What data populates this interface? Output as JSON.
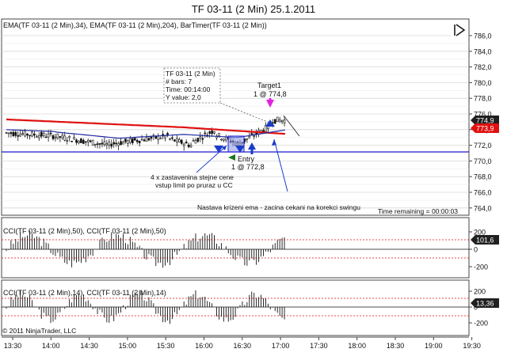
{
  "window": {
    "title": "TF 03-11 (2 Min)  25.1.2011"
  },
  "colors": {
    "ema_fast": "#1f2a9e",
    "ema_slow": "#e01010",
    "hline": "#1a1ad0",
    "price_tag": "#e01010",
    "price_tag2": "#202020",
    "grid": "#d8d8d8",
    "arrow": "#1a3cc8",
    "target": "#e020e0",
    "entry": "#1a7a1a"
  },
  "toolbar": {
    "collapse_icon": "collapse-right-icon"
  },
  "price_panel": {
    "indicator_label": "EMA(TF 03-11 (2 Min),34), EMA(TF 03-11 (2 Min),204), BarTimer(TF 03-11 (2 Min))",
    "y_ticks": [
      "786,0",
      "784,0",
      "782,0",
      "780,0",
      "778,0",
      "776,0",
      "774,0",
      "772,0",
      "770,0",
      "768,0",
      "766,0",
      "764,0"
    ],
    "last_price": "774,9",
    "ema_value": "773,9",
    "tooltip": {
      "line1": "TF 03-11 (2 Min)",
      "line2": "# bars:   7",
      "line3": "Time:     00:14:00",
      "line4": "Y value: 2,0"
    },
    "target_label1": "Target1",
    "target_label2": "1 @ 774,8",
    "entry_label1": "Entry",
    "entry_label2": "1 @ 772,8",
    "note_limit1": "4 x zastavenina stejne cene",
    "note_limit2": "vstup limit po pruraz u CC",
    "note_cross": "Nastava krizeni ema - zacina cekani na korekci swingu",
    "time_remaining": "Time remaining = 00:00:03"
  },
  "cci_panel_1": {
    "label": "CCI(TF 03-11 (2 Min),50), CCI(TF 03-11 (2 Min),50)",
    "y_ticks": [
      "200",
      "0",
      "-200"
    ],
    "last_value": "101,6"
  },
  "cci_panel_2": {
    "label": "CCI(TF 03-11 (2 Min),14), CCI(TF 03-11 (2 Min),14)",
    "y_ticks": [
      "200",
      "0",
      "-200"
    ],
    "last_value": "13,36"
  },
  "footer": {
    "copyright": "© 2011 NinjaTrader, LLC"
  },
  "time_axis": [
    "13:30",
    "14:00",
    "14:30",
    "15:00",
    "15:30",
    "16:00",
    "16:30",
    "17:00",
    "17:30",
    "18:00",
    "18:30",
    "19:00",
    "19:30"
  ]
}
